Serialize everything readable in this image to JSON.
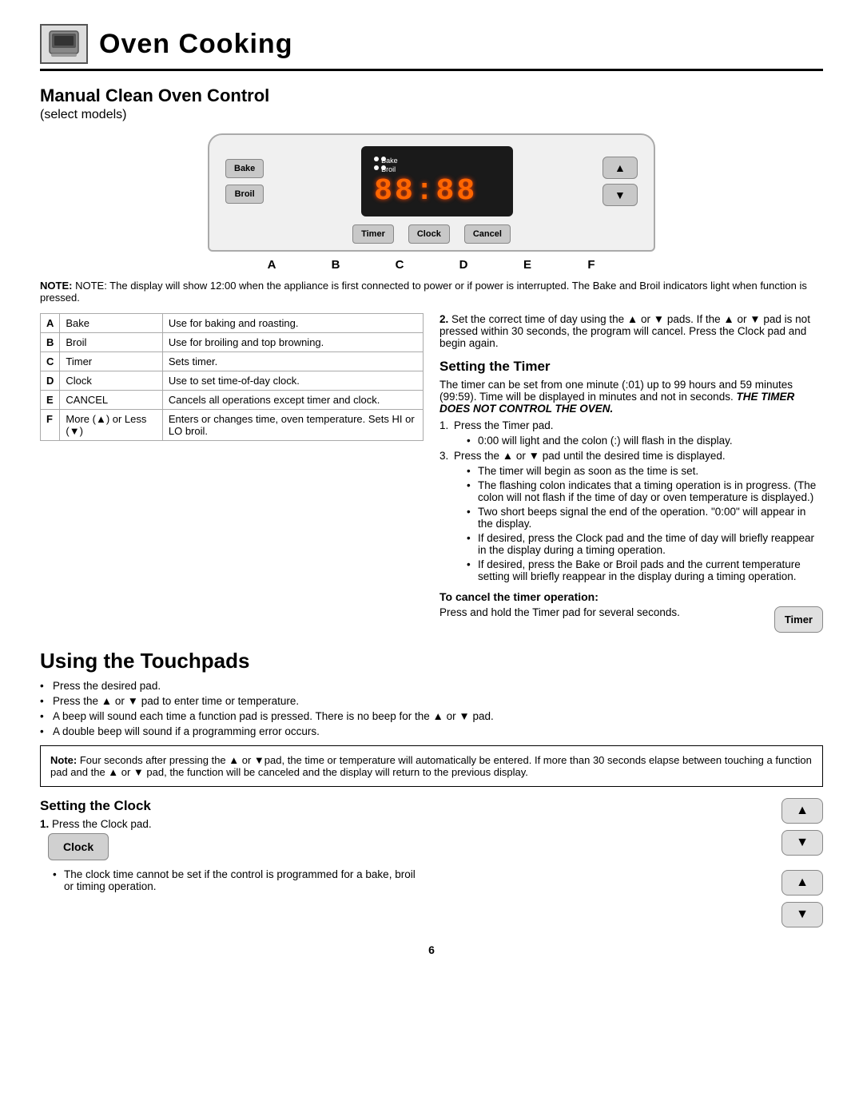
{
  "header": {
    "title": "Oven Cooking"
  },
  "manual_clean": {
    "title": "Manual Clean Oven Control",
    "subtitle": "(select models)"
  },
  "panel": {
    "bake_label": "Bake",
    "broil_label": "Broil",
    "display": "88:88",
    "bake_display_label": "Bake",
    "broil_display_label": "Broil",
    "timer_btn": "Timer",
    "clock_btn": "Clock",
    "cancel_btn": "Cancel",
    "up_arrow": "▲",
    "down_arrow": "▼"
  },
  "labels_row": [
    "A",
    "B",
    "C",
    "D",
    "E",
    "F"
  ],
  "note": "NOTE: The display will show 12:00 when the appliance is first connected to power or if power is interrupted. The Bake and Broil indicators light when function is pressed.",
  "table": {
    "rows": [
      {
        "key": "A",
        "item": "Bake",
        "desc": "Use for baking and roasting."
      },
      {
        "key": "B",
        "item": "Broil",
        "desc": "Use for broiling and top browning."
      },
      {
        "key": "C",
        "item": "Timer",
        "desc": "Sets timer."
      },
      {
        "key": "D",
        "item": "Clock",
        "desc": "Use to set time-of-day clock."
      },
      {
        "key": "E",
        "item": "CANCEL",
        "desc": "Cancels all operations except timer and clock."
      },
      {
        "key": "F",
        "item": "More (▲) or Less (▼)",
        "desc": "Enters or changes time, oven temperature.  Sets HI or LO broil."
      }
    ]
  },
  "right_col": {
    "step2": "Set the correct time of day using the ▲ or ▼ pads. If the ▲ or ▼ pad is not pressed within 30 seconds, the program will cancel. Press the Clock pad and begin again.",
    "setting_timer_title": "Setting the Timer",
    "setting_timer_desc": "The timer can be set from one minute (:01) up to 99 hours and 59 minutes (99:59). Time will be displayed in minutes and not in seconds.",
    "timer_bold": "THE TIMER DOES NOT CONTROL THE OVEN.",
    "timer_steps": [
      "Press the Timer pad.",
      "Press the ▲ or ▼ pad until the desired time is displayed."
    ],
    "timer_sub1_1": "0:00 will light and the colon (:) will flash in the display.",
    "timer_sub2_1": "The timer will begin as soon as the time is set.",
    "timer_sub2_2": "The flashing colon indicates that a timing operation is in progress. (The colon will not flash if the time of day or oven temperature is displayed.)",
    "timer_sub2_3": "Two short beeps signal the end of the operation. \"0:00\" will appear in the display.",
    "timer_sub2_4": "If desired, press the Clock pad and the time of day will briefly reappear in the display during a timing operation.",
    "timer_sub2_5": "If desired, press the Bake or Broil pads and the current temperature setting will briefly reappear in the display during a timing operation.",
    "cancel_title": "To cancel the timer operation:",
    "cancel_desc": "Press and hold the Timer pad for several seconds.",
    "timer_btn_label": "Timer"
  },
  "touchpads": {
    "title": "Using the Touchpads",
    "bullets": [
      "Press the desired pad.",
      "Press the ▲ or ▼ pad to enter time or temperature.",
      "A beep will sound each time a function pad is pressed. There is no beep for the ▲ or ▼ pad.",
      "A double beep will sound if a programming error occurs."
    ],
    "note_title": "Note:",
    "note_text": "Four seconds after pressing the ▲ or ▼pad, the time or temperature will automatically be entered. If more than 30 seconds elapse between touching a function pad and the ▲ or ▼ pad, the function will be canceled and the display will return to the previous display."
  },
  "clock": {
    "title": "Setting the Clock",
    "step1": "Press the Clock pad.",
    "clock_btn_label": "Clock",
    "sub_bullet": "The clock time cannot be set if the control is programmed for a bake, broil or timing operation."
  },
  "page_number": "6"
}
